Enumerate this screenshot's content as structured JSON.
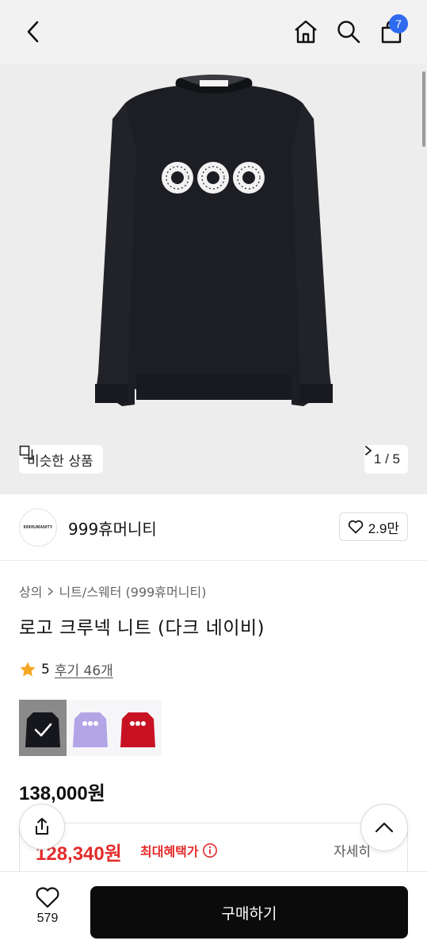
{
  "header": {
    "back_icon": "chevron-left-icon",
    "home_icon": "home-icon",
    "search_icon": "search-icon",
    "cart_icon": "shopping-bag-icon",
    "cart_count": "7"
  },
  "gallery": {
    "similar_label": "비슷한 상품",
    "pager_label": "1 / 5",
    "image_description": "navy sweater with 999 logo"
  },
  "brand": {
    "logo_text": "999HUMANITY",
    "name": "999휴머니티",
    "likes": "2.9만"
  },
  "breadcrumb": {
    "level1": "상의",
    "level2": "니트/스웨터 (999휴머니티)"
  },
  "product": {
    "title": "로고 크루넥 니트 (다크 네이비)",
    "rating": "5",
    "reviews": "후기 46개",
    "swatches": [
      "dark-navy",
      "lavender",
      "red"
    ],
    "price": "138,000원",
    "benefit_price": "128,340원",
    "benefit_label": "최대혜택가",
    "detail_link": "자세히"
  },
  "bottom": {
    "wish_count": "579",
    "buy_label": "구매하기"
  },
  "colors": {
    "accent_blue": "#2f6bf0",
    "sale_red": "#e42b2b",
    "buy_button": "#0b0b0b"
  }
}
